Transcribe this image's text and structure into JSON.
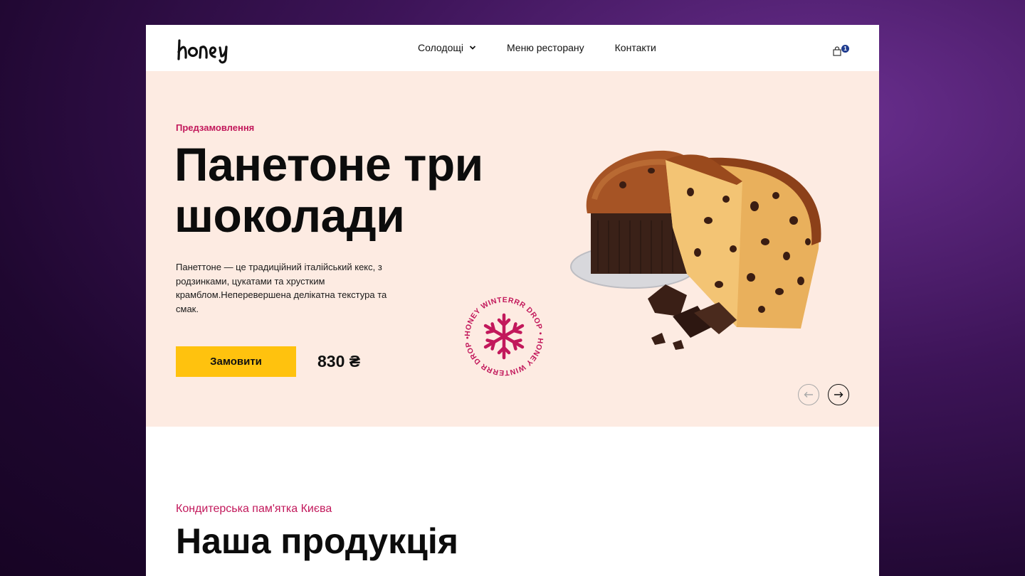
{
  "header": {
    "logo_text": "honey",
    "nav": [
      {
        "label": "Солодощі",
        "has_dropdown": true
      },
      {
        "label": "Меню ресторану"
      },
      {
        "label": "Контакти"
      }
    ],
    "cart_count": "1",
    "cart_badge_color": "#1f3c8f"
  },
  "hero": {
    "kicker": "Предзамовлення",
    "title": "Панетоне три шоколади",
    "description": "Панеттоне — це традиційний італійський кекс, з родзинками, цукатами та хрустким крамблом.Неперевершена делікатна текстура та смак.",
    "order_label": "Замовити",
    "price": "830 ₴",
    "badge_text": "HONEY WINTERRR DROP • HONEY WINTERRR DROP •",
    "background_color": "#fdebe2",
    "button_color": "#ffc20e",
    "accent_color": "#c2185b"
  },
  "products": {
    "kicker": "Кондитерська пам'ятка Києва",
    "title": "Наша продукція"
  }
}
